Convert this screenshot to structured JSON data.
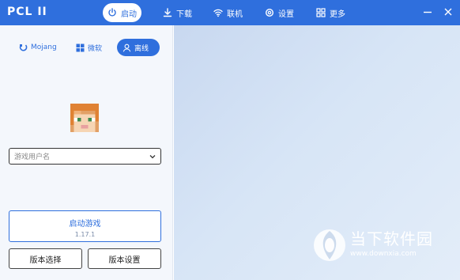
{
  "app": {
    "title": "PCL II"
  },
  "nav": [
    {
      "label": "启动",
      "icon": "power-icon",
      "active": true
    },
    {
      "label": "下载",
      "icon": "download-icon",
      "active": false
    },
    {
      "label": "联机",
      "icon": "wifi-icon",
      "active": false
    },
    {
      "label": "设置",
      "icon": "gear-icon",
      "active": false
    },
    {
      "label": "更多",
      "icon": "grid-icon",
      "active": false
    }
  ],
  "login_tabs": [
    {
      "label": "Mojang",
      "icon": "mojang-icon",
      "active": false
    },
    {
      "label": "微软",
      "icon": "windows-icon",
      "active": false
    },
    {
      "label": "离线",
      "icon": "user-icon",
      "active": true
    }
  ],
  "username": {
    "placeholder": "游戏用户名",
    "value": ""
  },
  "launch": {
    "title": "启动游戏",
    "version": "1.17.1"
  },
  "buttons": {
    "version_select": "版本选择",
    "version_settings": "版本设置"
  },
  "watermark": {
    "title": "当下软件园",
    "url": "www.downxia.com"
  },
  "colors": {
    "accent": "#2f6fdd",
    "sidebar_bg": "#f4f7fc",
    "main_bg": "#d7e5f6"
  }
}
